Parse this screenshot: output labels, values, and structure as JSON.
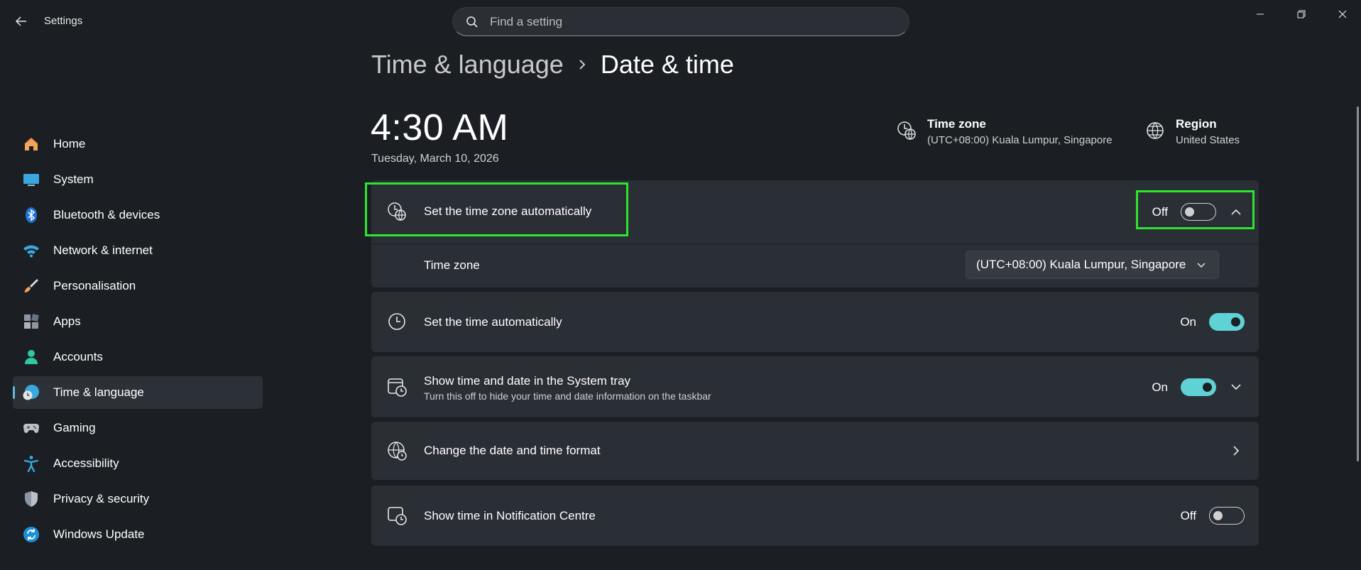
{
  "window": {
    "title": "Settings",
    "search_placeholder": "Find a setting"
  },
  "sidebar": {
    "items": [
      {
        "label": "Home",
        "icon": "home-icon"
      },
      {
        "label": "System",
        "icon": "system-icon"
      },
      {
        "label": "Bluetooth & devices",
        "icon": "bluetooth-icon"
      },
      {
        "label": "Network & internet",
        "icon": "wifi-icon"
      },
      {
        "label": "Personalisation",
        "icon": "brush-icon"
      },
      {
        "label": "Apps",
        "icon": "apps-icon"
      },
      {
        "label": "Accounts",
        "icon": "account-icon"
      },
      {
        "label": "Time & language",
        "icon": "time-language-icon",
        "active": true
      },
      {
        "label": "Gaming",
        "icon": "gamepad-icon"
      },
      {
        "label": "Accessibility",
        "icon": "accessibility-icon"
      },
      {
        "label": "Privacy & security",
        "icon": "shield-icon"
      },
      {
        "label": "Windows Update",
        "icon": "update-icon"
      }
    ]
  },
  "breadcrumb": {
    "parent": "Time & language",
    "current": "Date & time"
  },
  "clock": {
    "time": "4:30 AM",
    "date": "Tuesday, March 10, 2026"
  },
  "summary": {
    "timezone_title": "Time zone",
    "timezone_value": "(UTC+08:00) Kuala Lumpur, Singapore",
    "region_title": "Region",
    "region_value": "United States"
  },
  "settings": {
    "auto_timezone": {
      "title": "Set the time zone automatically",
      "state": "Off"
    },
    "timezone_row": {
      "title": "Time zone",
      "value": "(UTC+08:00) Kuala Lumpur, Singapore"
    },
    "auto_time": {
      "title": "Set the time automatically",
      "state": "On"
    },
    "system_tray": {
      "title": "Show time and date in the System tray",
      "subtitle": "Turn this off to hide your time and date information on the taskbar",
      "state": "On"
    },
    "format": {
      "title": "Change the date and time format"
    },
    "notification_centre": {
      "title": "Show time in Notification Centre",
      "state": "Off"
    }
  },
  "colors": {
    "accent": "#5fd2d6",
    "highlight": "#2ee52e",
    "background": "#1b1f24",
    "card": "#2a2e35"
  }
}
